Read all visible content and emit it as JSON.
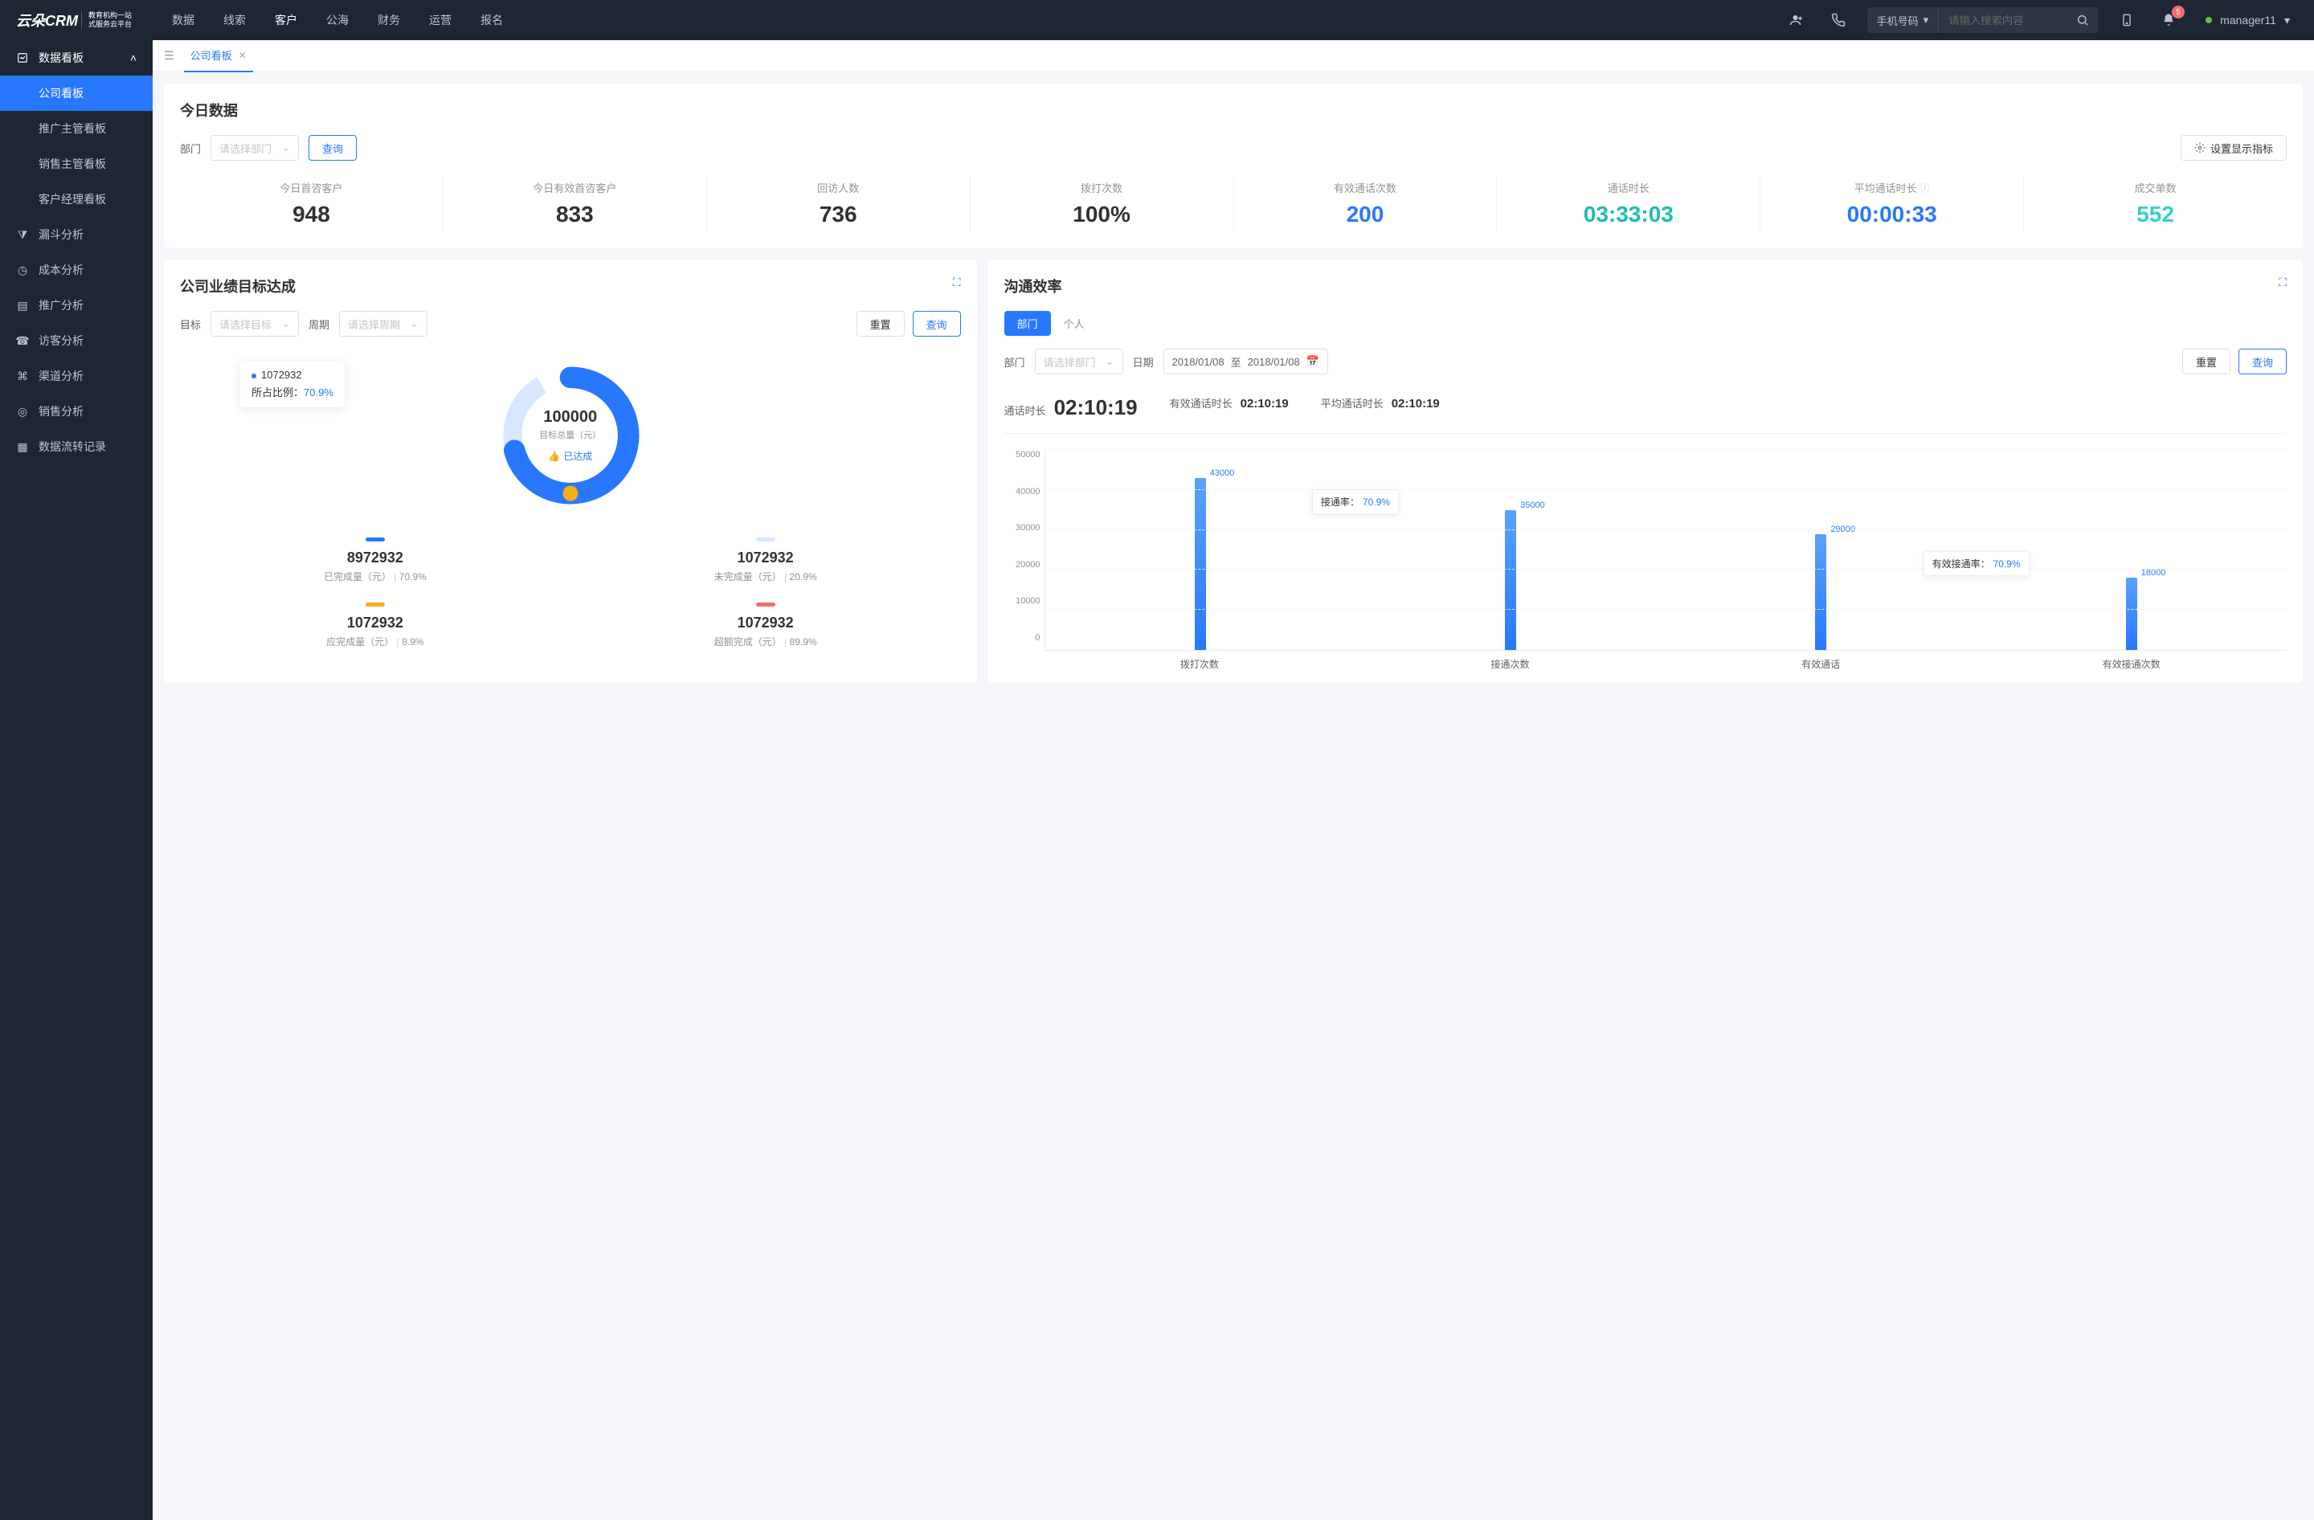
{
  "brand": {
    "name": "云朵CRM",
    "tagline1": "教育机构一站",
    "tagline2": "式服务云平台"
  },
  "topnav": [
    "数据",
    "线索",
    "客户",
    "公海",
    "财务",
    "运营",
    "报名"
  ],
  "topnav_active": 2,
  "search": {
    "type": "手机号码",
    "placeholder": "请输入搜索内容"
  },
  "notif_count": "5",
  "user": {
    "name": "manager11"
  },
  "sidebar": {
    "group": "数据看板",
    "subs": [
      "公司看板",
      "推广主管看板",
      "销售主管看板",
      "客户经理看板"
    ],
    "sub_active": 0,
    "items": [
      "漏斗分析",
      "成本分析",
      "推广分析",
      "访客分析",
      "渠道分析",
      "销售分析",
      "数据流转记录"
    ]
  },
  "tab": {
    "label": "公司看板"
  },
  "today": {
    "title": "今日数据",
    "dept_label": "部门",
    "dept_placeholder": "请选择部门",
    "query": "查询",
    "settings": "设置显示指标",
    "stats": [
      {
        "label": "今日首咨客户",
        "value": "948",
        "cls": "c-dark"
      },
      {
        "label": "今日有效首咨客户",
        "value": "833",
        "cls": "c-dark"
      },
      {
        "label": "回访人数",
        "value": "736",
        "cls": "c-dark"
      },
      {
        "label": "拨打次数",
        "value": "100%",
        "cls": "c-dark"
      },
      {
        "label": "有效通话次数",
        "value": "200",
        "cls": "c-blue"
      },
      {
        "label": "通话时长",
        "value": "03:33:03",
        "cls": "c-teal"
      },
      {
        "label": "平均通话时长",
        "value": "00:00:33",
        "cls": "c-blue",
        "info": true
      },
      {
        "label": "成交单数",
        "value": "552",
        "cls": "c-cyan"
      }
    ]
  },
  "goal": {
    "title": "公司业绩目标达成",
    "target_label": "目标",
    "target_placeholder": "请选择目标",
    "period_label": "周期",
    "period_placeholder": "请选择周期",
    "reset": "重置",
    "query": "查询",
    "tooltip_value": "1072932",
    "tooltip_ratio_label": "所占比例：",
    "tooltip_ratio": "70.9%",
    "center_num": "100000",
    "center_label": "目标总量（元）",
    "center_status": "已达成",
    "legends": [
      {
        "color": "#2878ff",
        "value": "8972932",
        "sub": "已完成量（元）",
        "pct": "70.9%"
      },
      {
        "color": "#d8e6ff",
        "value": "1072932",
        "sub": "未完成量（元）",
        "pct": "20.9%"
      },
      {
        "color": "#faad14",
        "value": "1072932",
        "sub": "应完成量（元）",
        "pct": "8.9%"
      },
      {
        "color": "#f56c6c",
        "value": "1072932",
        "sub": "超额完成（元）",
        "pct": "89.9%"
      }
    ]
  },
  "comm": {
    "title": "沟通效率",
    "tabs": [
      "部门",
      "个人"
    ],
    "tab_active": 0,
    "dept_label": "部门",
    "dept_placeholder": "请选择部门",
    "date_label": "日期",
    "date_from": "2018/01/08",
    "date_to": "2018/01/08",
    "date_sep": "至",
    "reset": "重置",
    "query": "查询",
    "metrics": [
      {
        "label": "通话时长",
        "value": "02:10:19",
        "big": true
      },
      {
        "label": "有效通话时长",
        "value": "02:10:19"
      },
      {
        "label": "平均通话时长",
        "value": "02:10:19"
      }
    ],
    "anno1": {
      "label": "接通率：",
      "rate": "70.9%"
    },
    "anno2": {
      "label": "有效接通率：",
      "rate": "70.9%"
    }
  },
  "chart_data": {
    "type": "bar",
    "categories": [
      "拨打次数",
      "接通次数",
      "有效通话",
      "有效接通次数"
    ],
    "values": [
      43000,
      35000,
      29000,
      18000
    ],
    "ylim": [
      0,
      50000
    ],
    "yticks": [
      0,
      10000,
      20000,
      30000,
      40000,
      50000
    ],
    "annotations": [
      {
        "between": [
          0,
          1
        ],
        "label": "接通率：",
        "rate": "70.9%"
      },
      {
        "between": [
          2,
          3
        ],
        "label": "有效接通率：",
        "rate": "70.9%"
      }
    ]
  }
}
